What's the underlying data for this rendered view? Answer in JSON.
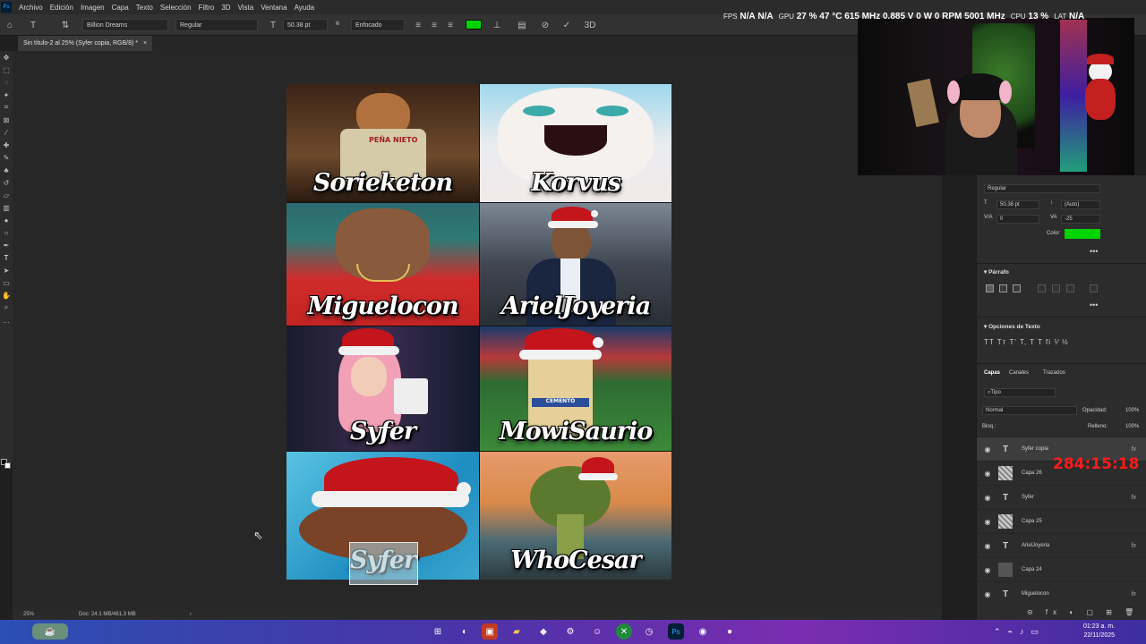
{
  "menubar": {
    "items": [
      "Archivo",
      "Edición",
      "Imagen",
      "Capa",
      "Texto",
      "Selección",
      "Filtro",
      "3D",
      "Vista",
      "Ventana",
      "Ayuda"
    ]
  },
  "stats_overlay": {
    "fps_label": "FPS",
    "fps_val1": "N/A",
    "fps_val2": "N/A",
    "gpu_label": "GPU",
    "gpu_val": "27 %  47 °C  615 MHz  0.885 V  0 W  0 RPM  5001 MHz",
    "cpu_label": "CPU",
    "cpu_val": "13 %",
    "lat_label": "LAT",
    "lat_val": "N/A"
  },
  "options": {
    "font_family": "Billion Dreams",
    "font_style": "Regular",
    "font_size": "50.38 pt",
    "antialias": "Enfocado",
    "color": "#00d400"
  },
  "document": {
    "tab_title": "Sin título-2 al 25% (Syfer copia, RGB/8) *",
    "zoom": "25%",
    "doc_size": "Doc: 24.1 MB/461.3 MB"
  },
  "tiles": [
    {
      "name": "Sorieketon",
      "bg": "#5a3a22"
    },
    {
      "name": "Korvus",
      "bg": "#bfe6f3"
    },
    {
      "name": "Miguelocon",
      "bg": "#c82d2d"
    },
    {
      "name": "ArielJoyeria",
      "bg": "#2b2f36"
    },
    {
      "name": "Syfer",
      "bg": "#1b1830"
    },
    {
      "name": "MowiSaurio",
      "bg": "#2f6a30"
    },
    {
      "name": "Syfer",
      "bg": "#2ea0c8"
    },
    {
      "name": "WhoCesar",
      "bg": "#d98a4a"
    }
  ],
  "tile_texts": {
    "pena_nieto": "PEÑA NIETO",
    "cemento": "CEMENTO"
  },
  "character_panel": {
    "style": "Regular",
    "size": "50.38 pt",
    "leading": "(Auto)",
    "kerning": "0",
    "tracking": "-25",
    "color_label": "Color",
    "color": "#00d400"
  },
  "paragraph_panel": {
    "title": "Párrafo"
  },
  "text_options_panel": {
    "title": "Opciones de Texto",
    "glyphs": "TT Tт T' T, T T  fi ⅟ ½"
  },
  "layers_panel": {
    "tabs": [
      "Capas",
      "Canales",
      "Trazados"
    ],
    "search_placeholder": "Tipo",
    "blend_mode": "Normal",
    "opacity_label": "Opacidad:",
    "opacity": "100%",
    "lock_label": "Bloq.:",
    "fill_label": "Relleno:",
    "fill": "100%",
    "layers": [
      {
        "name": "Syfer copia",
        "type": "text",
        "fx": true,
        "selected": true
      },
      {
        "name": "Capa 26",
        "type": "pixel",
        "fx": false
      },
      {
        "name": "Syfer",
        "type": "text",
        "fx": true
      },
      {
        "name": "Capa 25",
        "type": "pixel",
        "fx": false
      },
      {
        "name": "ArielJoyeria",
        "type": "text",
        "fx": true
      },
      {
        "name": "Capa 24",
        "type": "pixel",
        "fx": false
      },
      {
        "name": "Miguelocon",
        "type": "text",
        "fx": true
      }
    ]
  },
  "timer": "284:15:18",
  "taskbar": {
    "time": "01:23 a. m.",
    "date": "22/11/2025"
  }
}
